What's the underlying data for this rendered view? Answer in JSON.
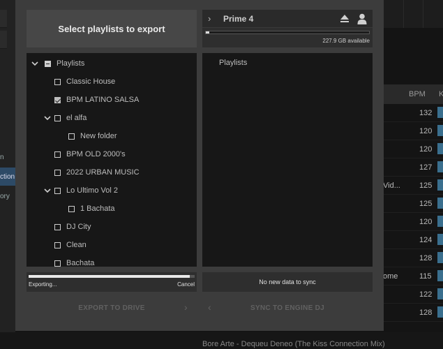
{
  "background": {
    "sidebar": [
      "n",
      "ction",
      "ory"
    ],
    "bpm_header": "BPM",
    "key_header": "K",
    "rows": [
      {
        "bpm": "132",
        "ext": ""
      },
      {
        "bpm": "120",
        "ext": ""
      },
      {
        "bpm": "120",
        "ext": ""
      },
      {
        "bpm": "127",
        "ext": ""
      },
      {
        "bpm": "125",
        "ext": "Vid..."
      },
      {
        "bpm": "125",
        "ext": ""
      },
      {
        "bpm": "120",
        "ext": ""
      },
      {
        "bpm": "124",
        "ext": ""
      },
      {
        "bpm": "128",
        "ext": ""
      },
      {
        "bpm": "115",
        "ext": "ome"
      },
      {
        "bpm": "122",
        "ext": ""
      },
      {
        "bpm": "128",
        "ext": ""
      }
    ],
    "bottom_text": "Bore Arte - Dequeu Deneo (The Kiss Connection Mix)"
  },
  "export_panel": {
    "title": "Select playlists to export",
    "tree": {
      "root_label": "Playlists",
      "items": [
        {
          "label": "Classic House",
          "checked": false
        },
        {
          "label": "BPM LATINO SALSA",
          "checked": true
        },
        {
          "label": "el alfa",
          "checked": false
        },
        {
          "label": "New folder",
          "checked": false
        },
        {
          "label": "BPM OLD 2000's",
          "checked": false
        },
        {
          "label": "2022 URBAN MUSIC",
          "checked": false
        },
        {
          "label": "Lo Ultimo Vol 2",
          "checked": false
        },
        {
          "label": "1 Bachata",
          "checked": false
        },
        {
          "label": "DJ City",
          "checked": false
        },
        {
          "label": "Clean",
          "checked": false
        },
        {
          "label": "Bachata",
          "checked": false
        }
      ]
    },
    "progress_value": 0.97,
    "progress_label": "Exporting...",
    "cancel_label": "Cancel",
    "export_button": "EXPORT TO DRIVE"
  },
  "device_panel": {
    "device_name": "Prime 4",
    "storage_used": 0.02,
    "storage_text": "227.9 GB available",
    "list_title": "Playlists",
    "sync_status": "No new data to sync",
    "sync_button": "SYNC TO ENGINE DJ"
  }
}
